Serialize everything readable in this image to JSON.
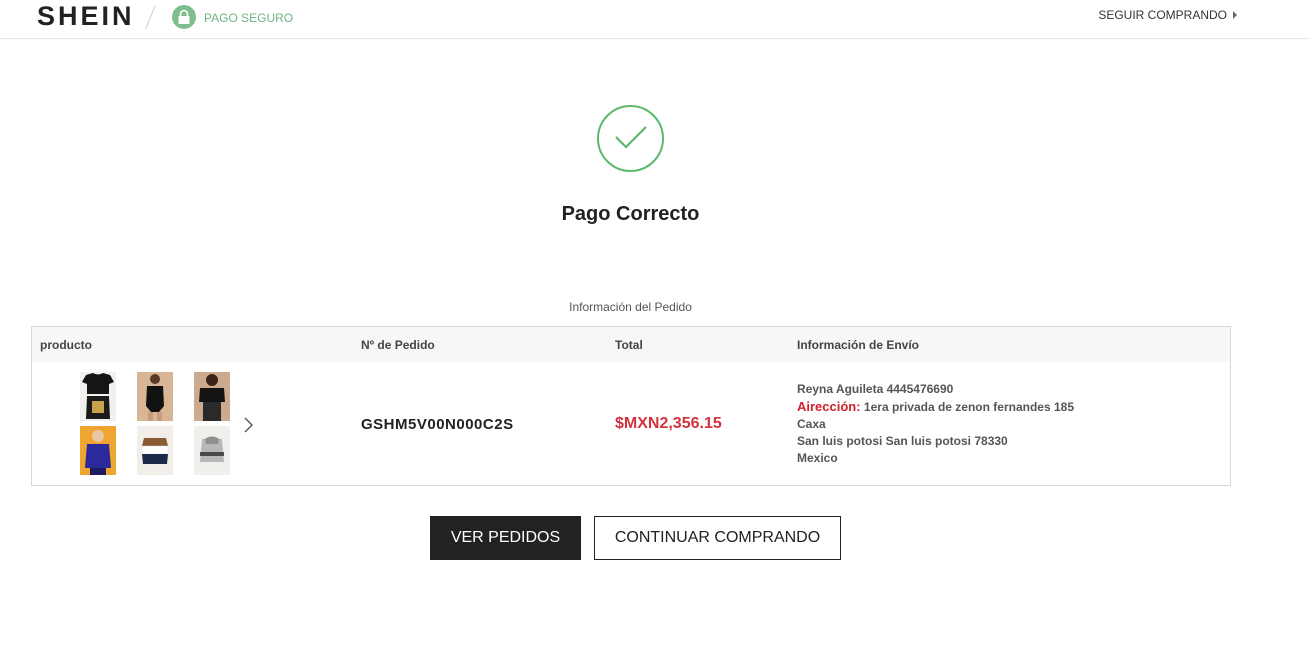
{
  "header": {
    "logo": "SHEIN",
    "secure_label": "PAGO SEGURO",
    "continue_link": "SEGUIR COMPRANDO"
  },
  "success": {
    "title": "Pago Correcto"
  },
  "order": {
    "section_label": "Información del Pedido",
    "columns": {
      "product": "producto",
      "order_number": "Nº de Pedido",
      "total": "Total",
      "shipping": "Información de Envío"
    },
    "order_number": "GSHM5V00N000C2S",
    "total": "$MXN2,356.15",
    "shipping": {
      "name_phone": "Reyna Aguileta 4445476690",
      "address_label": "Airección:",
      "address_line1": "1era privada de zenon fernandes 185",
      "address_line2": "Caxa",
      "city_line": "San luis potosi San luis potosi 78330",
      "country": "Mexico"
    }
  },
  "buttons": {
    "view_orders": "VER PEDIDOS",
    "continue_shopping": "CONTINUAR COMPRANDO"
  },
  "colors": {
    "accent_green": "#5cb86a",
    "price_red": "#d0333f",
    "dark_button": "#222222"
  }
}
